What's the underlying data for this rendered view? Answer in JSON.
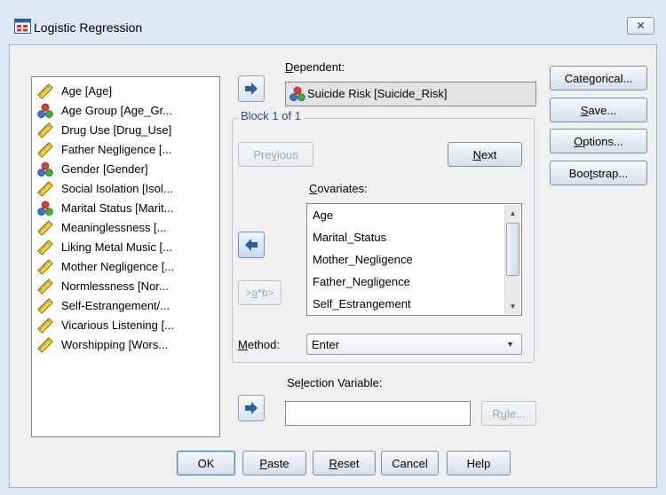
{
  "window": {
    "title": "Logistic Regression",
    "close_label": "✕"
  },
  "variables": [
    {
      "label": "Age [Age]",
      "icon": "scale-ruler-icon"
    },
    {
      "label": "Age Group [Age_Gr...",
      "icon": "nominal-balls-icon"
    },
    {
      "label": "Drug Use [Drug_Use]",
      "icon": "scale-ruler-icon"
    },
    {
      "label": "Father Negligence [...",
      "icon": "scale-ruler-icon"
    },
    {
      "label": "Gender [Gender]",
      "icon": "nominal-balls-icon"
    },
    {
      "label": "Social Isolation [Isol...",
      "icon": "scale-ruler-icon"
    },
    {
      "label": "Marital Status [Marit...",
      "icon": "nominal-balls-icon"
    },
    {
      "label": "Meaninglessness [...",
      "icon": "scale-ruler-icon"
    },
    {
      "label": "Liking Metal Music [...",
      "icon": "scale-ruler-icon"
    },
    {
      "label": "Mother Negligence [...",
      "icon": "scale-ruler-icon"
    },
    {
      "label": "Normlessness [Nor...",
      "icon": "scale-ruler-icon"
    },
    {
      "label": "Self-Estrangement/...",
      "icon": "scale-ruler-icon"
    },
    {
      "label": "Vicarious Listening [...",
      "icon": "scale-ruler-icon"
    },
    {
      "label": "Worshipping [Wors...",
      "icon": "scale-ruler-icon"
    }
  ],
  "dependent": {
    "label_pre": "",
    "label_mnemonic": "D",
    "label_post": "ependent:",
    "value": "Suicide Risk [Suicide_Risk]"
  },
  "block": {
    "label": "Block 1 of 1"
  },
  "previous": {
    "pre": "Pre",
    "mnemonic": "v",
    "post": "ious"
  },
  "next": {
    "pre": "",
    "mnemonic": "N",
    "post": "ext"
  },
  "covariates": {
    "label_pre": "",
    "label_mnemonic": "C",
    "label_post": "ovariates:",
    "items": [
      "Age",
      "Marital_Status",
      "Mother_Negligence",
      "Father_Negligence",
      "Self_Estrangement"
    ]
  },
  "interaction": {
    "pre": ">",
    "mnemonic": "a",
    "post": "*b>"
  },
  "method": {
    "label_pre": "",
    "label_mnemonic": "M",
    "label_post": "ethod:",
    "value": "Enter"
  },
  "selection": {
    "label_pre": "Se",
    "label_mnemonic": "l",
    "label_post": "ection Variable:",
    "value": ""
  },
  "rule": {
    "pre": "R",
    "mnemonic": "u",
    "post": "le..."
  },
  "side_buttons": {
    "categorical": {
      "pre": "Cate",
      "mnemonic": "g",
      "post": "orical..."
    },
    "save": {
      "pre": "",
      "mnemonic": "S",
      "post": "ave..."
    },
    "options": {
      "pre": "",
      "mnemonic": "O",
      "post": "ptions..."
    },
    "bootstrap": {
      "pre": "Boo",
      "mnemonic": "t",
      "post": "strap..."
    }
  },
  "bottom_buttons": {
    "ok": {
      "pre": "OK",
      "mnemonic": "",
      "post": ""
    },
    "paste": {
      "pre": "",
      "mnemonic": "P",
      "post": "aste"
    },
    "reset": {
      "pre": "",
      "mnemonic": "R",
      "post": "eset"
    },
    "cancel": {
      "pre": "Cancel",
      "mnemonic": "",
      "post": ""
    },
    "help": {
      "pre": "Help",
      "mnemonic": "",
      "post": ""
    }
  },
  "colors": {
    "accent": "#1f4e8c",
    "dialog_bg": "#f0f0f0",
    "frame_bg": "#dce7f3"
  }
}
